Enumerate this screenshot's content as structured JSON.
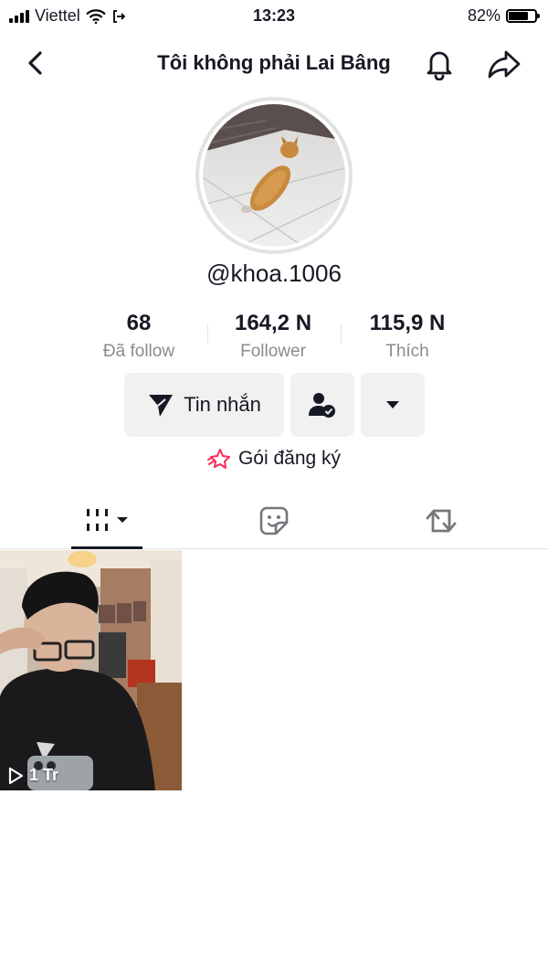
{
  "status_bar": {
    "carrier": "Viettel",
    "time": "13:23",
    "battery_percent": "82%",
    "battery_level": 0.82
  },
  "header": {
    "title": "Tôi không phải Lai Bâng"
  },
  "profile": {
    "username": "@khoa.1006"
  },
  "stats": [
    {
      "value": "68",
      "label": "Đã follow"
    },
    {
      "value": "164,2 N",
      "label": "Follower"
    },
    {
      "value": "115,9 N",
      "label": "Thích"
    }
  ],
  "actions": {
    "message_label": "Tin nhắn"
  },
  "subscription": {
    "label": "Gói đăng ký"
  },
  "videos": [
    {
      "views": "1 Tr"
    }
  ],
  "icons": {
    "back": "back-arrow-icon",
    "bell": "bell-icon",
    "share": "share-icon",
    "message": "send-icon",
    "friend": "user-check-icon",
    "more": "dropdown-icon",
    "subscription": "star-icon",
    "tab_videos": "grid-icon",
    "tab_favorites": "sticker-icon",
    "tab_reposts": "repost-icon"
  },
  "colors": {
    "text": "#161823",
    "muted": "#8a8b91",
    "button_bg": "#f1f1f2",
    "subscription_accent": "#fe2c55"
  }
}
